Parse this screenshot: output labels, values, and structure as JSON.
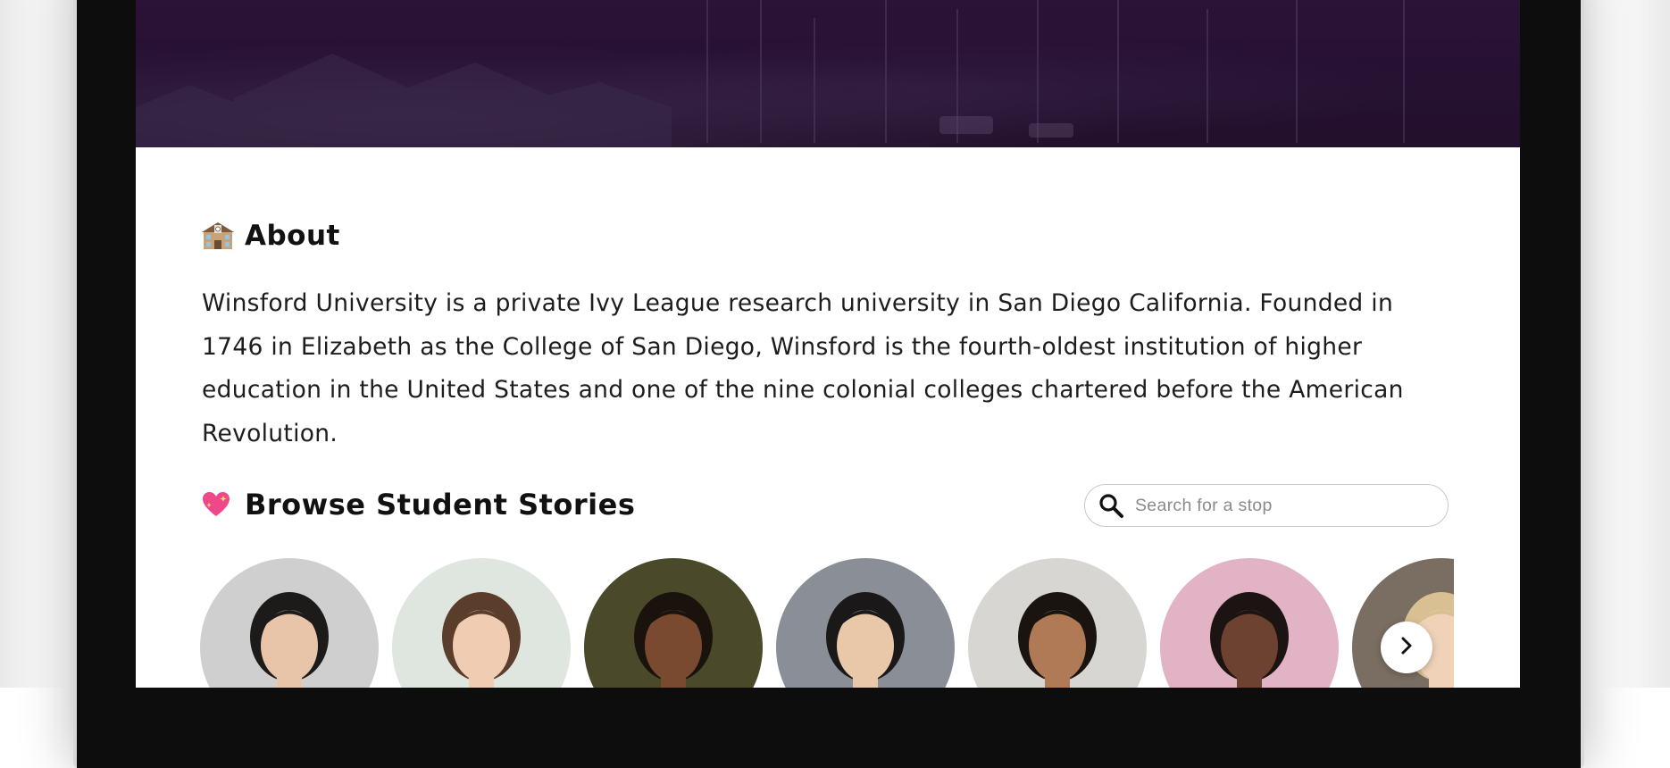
{
  "about": {
    "icon": "school-building-icon",
    "title": "About",
    "description": "Winsford University is a private Ivy League research university in San Diego California. Founded in 1746 in Elizabeth as the College of San Diego, Winsford is the fourth-oldest institution of higher education in the United States and one of the nine colonial colleges chartered before the American Revolution."
  },
  "stories": {
    "icon": "sparkling-heart-icon",
    "title": "Browse Student Stories",
    "search": {
      "icon": "search-icon",
      "placeholder": "Search for a stop"
    },
    "next_icon": "chevron-right-icon",
    "avatars": [
      {
        "name": "student-avatar-1",
        "bg": "#cfcfcf",
        "skin": "#e8c4a8",
        "hair": "#1d1a1a"
      },
      {
        "name": "student-avatar-2",
        "bg": "#dfe6df",
        "skin": "#f0cdb2",
        "hair": "#5a3d2a"
      },
      {
        "name": "student-avatar-3",
        "bg": "#4a4a2a",
        "skin": "#7a4a30",
        "hair": "#1a120c"
      },
      {
        "name": "student-avatar-4",
        "bg": "#8a8e96",
        "skin": "#e8c8a8",
        "hair": "#1a1818"
      },
      {
        "name": "student-avatar-5",
        "bg": "#d8d6d2",
        "skin": "#b07a56",
        "hair": "#1a1410"
      },
      {
        "name": "student-avatar-6",
        "bg": "#e2b3c4",
        "skin": "#6e4230",
        "hair": "#1c1412"
      },
      {
        "name": "student-avatar-7",
        "bg": "#7a6e62",
        "skin": "#f0d2b8",
        "hair": "#d8c092"
      }
    ]
  },
  "colors": {
    "hero": "#22102c",
    "text": "#1d1d1d",
    "heading": "#111111"
  }
}
